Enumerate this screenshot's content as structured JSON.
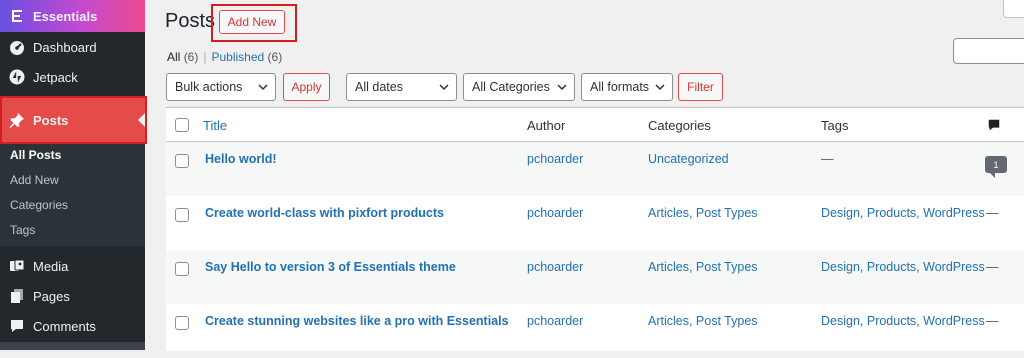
{
  "sidebar": {
    "brand": "Essentials",
    "items": [
      {
        "label": "Dashboard",
        "icon": "dashboard-icon"
      },
      {
        "label": "Jetpack",
        "icon": "jetpack-icon"
      },
      {
        "label": "Posts",
        "icon": "pushpin-icon"
      },
      {
        "label": "Media",
        "icon": "media-icon"
      },
      {
        "label": "Pages",
        "icon": "pages-icon"
      },
      {
        "label": "Comments",
        "icon": "comments-icon"
      }
    ],
    "submenu": [
      "All Posts",
      "Add New",
      "Categories",
      "Tags"
    ],
    "current_submenu": "All Posts"
  },
  "header": {
    "title": "Posts",
    "add_new": "Add New"
  },
  "views": {
    "all_label": "All",
    "all_count": "(6)",
    "separator": "|",
    "published_label": "Published",
    "published_count": "(6)"
  },
  "filters": {
    "bulk_actions": "Bulk actions",
    "apply": "Apply",
    "dates": "All dates",
    "categories": "All Categories",
    "formats": "All formats",
    "filter": "Filter"
  },
  "table": {
    "columns": {
      "title": "Title",
      "author": "Author",
      "categories": "Categories",
      "tags": "Tags"
    },
    "rows": [
      {
        "title": "Hello world!",
        "author": "pchoarder",
        "categories": "Uncategorized",
        "tags": "—",
        "comments": "1"
      },
      {
        "title": "Create world-class with pixfort products",
        "author": "pchoarder",
        "categories": "Articles, Post Types",
        "tags": "Design, Products, WordPress",
        "comments": "—"
      },
      {
        "title": "Say Hello to version 3 of Essentials theme",
        "author": "pchoarder",
        "categories": "Articles, Post Types",
        "tags": "Design, Products, WordPress",
        "comments": "—"
      },
      {
        "title": "Create stunning websites like a pro with Essentials",
        "author": "pchoarder",
        "categories": "Articles, Post Types",
        "tags": "Design, Products, WordPress",
        "comments": "—"
      }
    ]
  },
  "colors": {
    "sidebar_bg": "#23282d",
    "posts_active": "#e34c4a",
    "highlight_box": "#d31f1f",
    "link": "#2271b1",
    "brand_gradient": [
      "#6a4fe0",
      "#ee4a8e"
    ]
  }
}
